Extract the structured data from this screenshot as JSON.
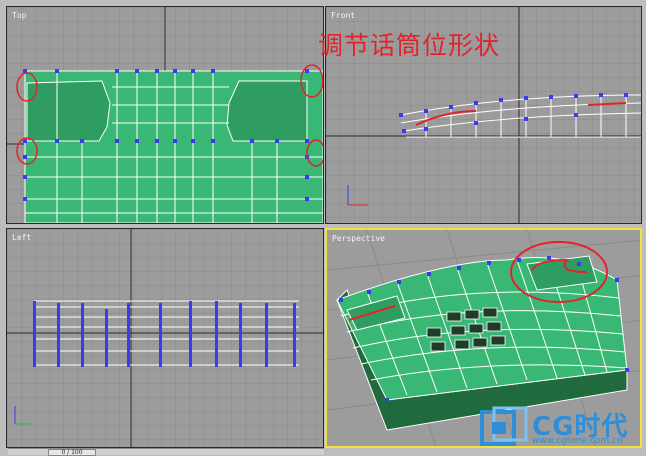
{
  "viewports": {
    "top": {
      "label": "Top"
    },
    "front": {
      "label": "Front"
    },
    "left": {
      "label": "Left"
    },
    "perspective": {
      "label": "Perspective",
      "active": true
    }
  },
  "annotation": {
    "text": "调节话筒位形状"
  },
  "timeline": {
    "frame_text": "0 / 100"
  },
  "logo": {
    "brand": "CG时代",
    "url": "www.cgtime.com.cn"
  },
  "colors": {
    "viewport_bg": "#9c9c9c",
    "grid": "#8a8a8a",
    "mesh_fill": "#39b774",
    "vertex": "#3a3af0",
    "annotation_red": "#e3232a",
    "active_border": "#f2e23a",
    "logo_blue": "#2e8fd8"
  }
}
